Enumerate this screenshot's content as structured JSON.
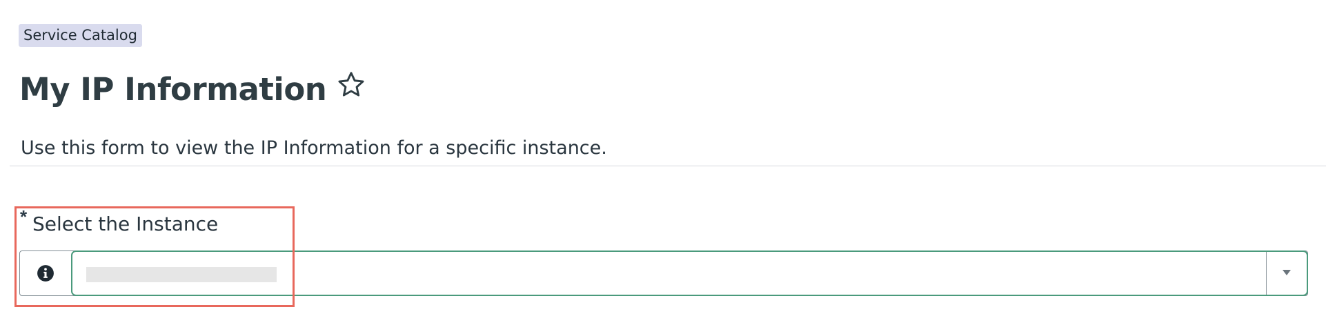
{
  "breadcrumb": {
    "label": "Service Catalog"
  },
  "header": {
    "title": "My IP Information",
    "favorite_icon": "star-outline-icon"
  },
  "form": {
    "description": "Use this form to view the IP Information for a specific instance.",
    "fields": [
      {
        "required_mark": "*",
        "label": "Select the Instance",
        "info_icon": "info-circle-icon",
        "value": "",
        "dropdown_icon": "caret-down-icon"
      }
    ]
  },
  "colors": {
    "breadcrumb_background": "#d9dbee",
    "select_focus_border": "#4a9a7c",
    "annotation_highlight": "#e8685c"
  }
}
